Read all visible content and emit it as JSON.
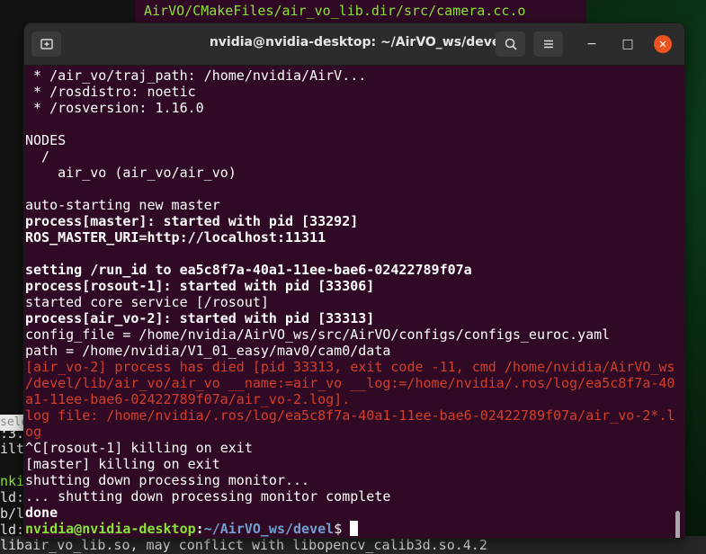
{
  "background": {
    "top_line": "AirVO/CMakeFiles/air_vo_lib.dir/src/camera.cc.o",
    "bottom_line": "libair_vo_lib.so, may conflict with libopencv_calib3d.so.4.2",
    "left_fragments": [
      "sele",
      "ilt",
      "nki",
      "ld:",
      "b/l",
      "ld:"
    ],
    "left_fragment_top": ":3."
  },
  "window": {
    "title": "nvidia@nvidia-desktop: ~/AirVO_ws/devel",
    "minimize": "−",
    "maximize": "□",
    "close": "✕",
    "new_tab_icon": "new-tab-icon",
    "search_icon": "search-icon",
    "menu_icon": "hamburger-menu-icon"
  },
  "terminal": {
    "lines": [
      " * /air_vo/traj_path: /home/nvidia/AirV...",
      " * /rosdistro: noetic",
      " * /rosversion: 1.16.0",
      "",
      "NODES",
      "  /",
      "    air_vo (air_vo/air_vo)",
      "",
      "auto-starting new master",
      "process[master]: started with pid [33292]",
      "ROS_MASTER_URI=http://localhost:11311",
      "",
      "setting /run_id to ea5c8f7a-40a1-11ee-bae6-02422789f07a",
      "process[rosout-1]: started with pid [33306]",
      "started core service [/rosout]",
      "process[air_vo-2]: started with pid [33313]",
      "config_file = /home/nvidia/AirVO_ws/src/AirVO/configs/configs_euroc.yaml",
      "path = /home/nvidia/V1_01_easy/mav0/cam0/data",
      "[air_vo-2] process has died [pid 33313, exit code -11, cmd /home/nvidia/AirVO_ws",
      "/devel/lib/air_vo/air_vo __name:=air_vo __log:=/home/nvidia/.ros/log/ea5c8f7a-40",
      "a1-11ee-bae6-02422789f07a/air_vo-2.log].",
      "log file: /home/nvidia/.ros/log/ea5c8f7a-40a1-11ee-bae6-02422789f07a/air_vo-2*.l",
      "og",
      "^C[rosout-1] killing on exit",
      "[master] killing on exit",
      "shutting down processing monitor...",
      "... shutting down processing monitor complete",
      "done"
    ],
    "prompt_user": "nvidia@nvidia-desktop",
    "prompt_colon": ":",
    "prompt_path": "~/AirVO_ws/devel",
    "prompt_symbol": "$ "
  },
  "colors": {
    "terminal_bg": "#300a24",
    "error_text": "#d23f2a",
    "prompt_user": "#8ae234",
    "prompt_path": "#729fcf",
    "close_button": "#e95420"
  }
}
